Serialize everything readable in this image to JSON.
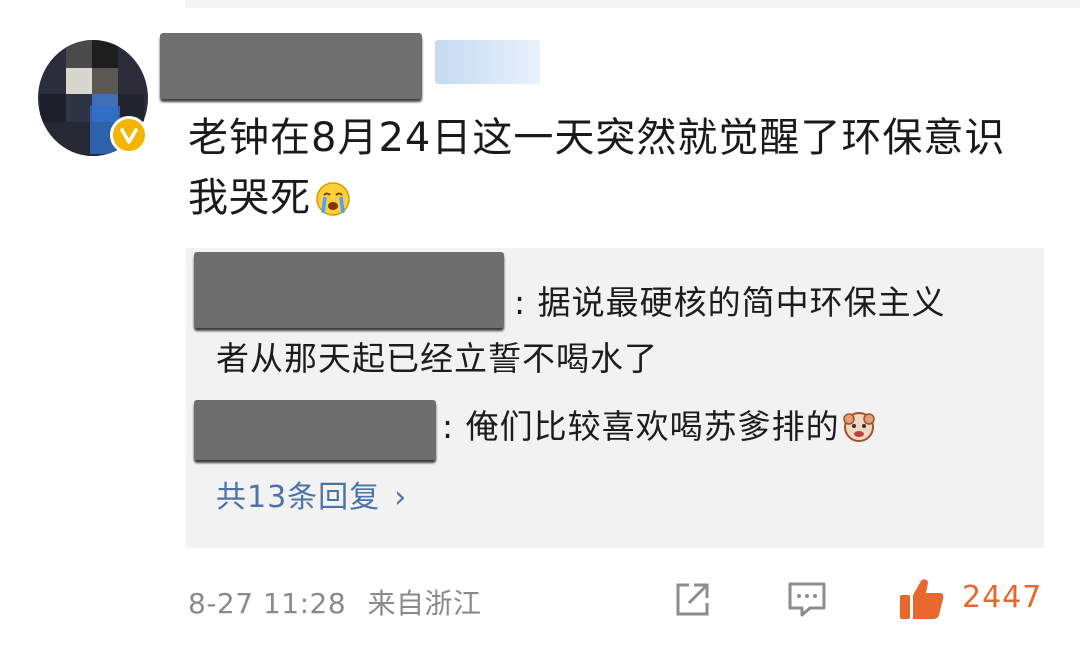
{
  "comment": {
    "text": "老钟在8月24日这一天突然就觉醒了环保意识我哭死",
    "emoji": "crying-face"
  },
  "replies": [
    {
      "separator": ": ",
      "text": "据说最硬核的简中环保主义者从那天起已经立誓不喝水了"
    },
    {
      "separator": ": ",
      "text": "俺们比较喜欢喝苏爹排的",
      "emoji": "monkey-face"
    }
  ],
  "more_replies": {
    "label": "共13条回复",
    "chevron": "›"
  },
  "footer": {
    "timestamp": "8-27 11:28",
    "location": "来自浙江",
    "like_count": "2447"
  },
  "colors": {
    "link": "#4a74a8",
    "like": "#e8672e",
    "badge": "#f5b400"
  }
}
